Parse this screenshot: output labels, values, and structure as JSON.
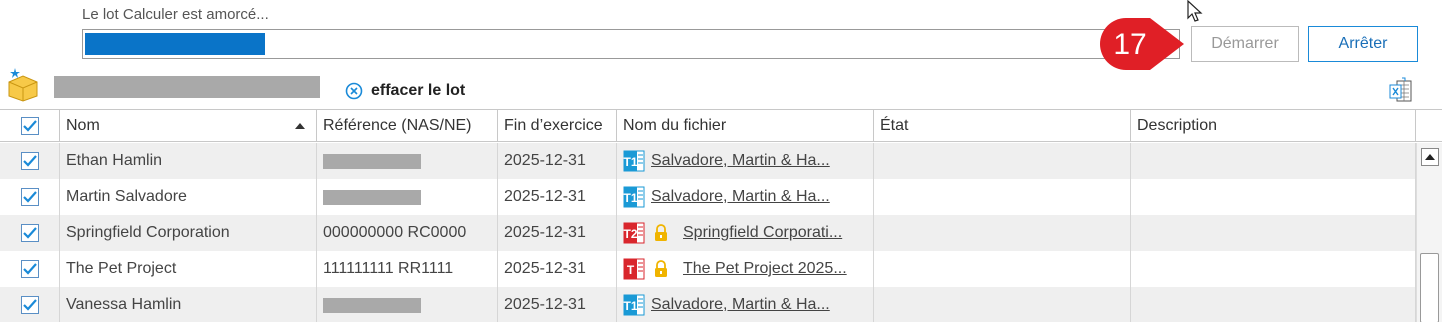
{
  "status": {
    "text": "Le lot Calculer est amorcé...",
    "progress_fraction": 0.165
  },
  "buttons": {
    "start": "Démarrer",
    "stop": "Arrêter"
  },
  "step_badge": {
    "number": "17",
    "color": "#e01f26"
  },
  "toolbar": {
    "clear_batch": "effacer le lot"
  },
  "columns": {
    "name": "Nom",
    "reference": "Référence (NAS/NE)",
    "fiscal_end": "Fin d’exercice",
    "file_name": "Nom du fichier",
    "state": "État",
    "description": "Description"
  },
  "rows": [
    {
      "name": "Ethan Hamlin",
      "reference": "",
      "reference_masked": true,
      "fiscal_end": "2025-12-31",
      "file_icon": "t1-icon",
      "locked": false,
      "file": "Salvadore, Martin & Ha..."
    },
    {
      "name": "Martin Salvadore",
      "reference": "",
      "reference_masked": true,
      "fiscal_end": "2025-12-31",
      "file_icon": "t1-icon",
      "locked": false,
      "file": "Salvadore, Martin & Ha..."
    },
    {
      "name": "Springfield Corporation",
      "reference": "000000000 RC0000",
      "reference_masked": false,
      "fiscal_end": "2025-12-31",
      "file_icon": "t2-icon",
      "locked": true,
      "file": "Springfield Corporati..."
    },
    {
      "name": "The Pet Project",
      "reference": "111111111 RR1111",
      "reference_masked": false,
      "fiscal_end": "2025-12-31",
      "file_icon": "t3010-icon",
      "locked": true,
      "file": "The Pet Project 2025..."
    },
    {
      "name": "Vanessa Hamlin",
      "reference": "",
      "reference_masked": true,
      "fiscal_end": "2025-12-31",
      "file_icon": "t1-icon",
      "locked": false,
      "file": "Salvadore, Martin & Ha..."
    }
  ],
  "colors": {
    "accent": "#1a8ad8",
    "progress": "#0a74c8",
    "t1": "#1a9ad6",
    "t2": "#d9262c",
    "lock": "#f0b400"
  }
}
